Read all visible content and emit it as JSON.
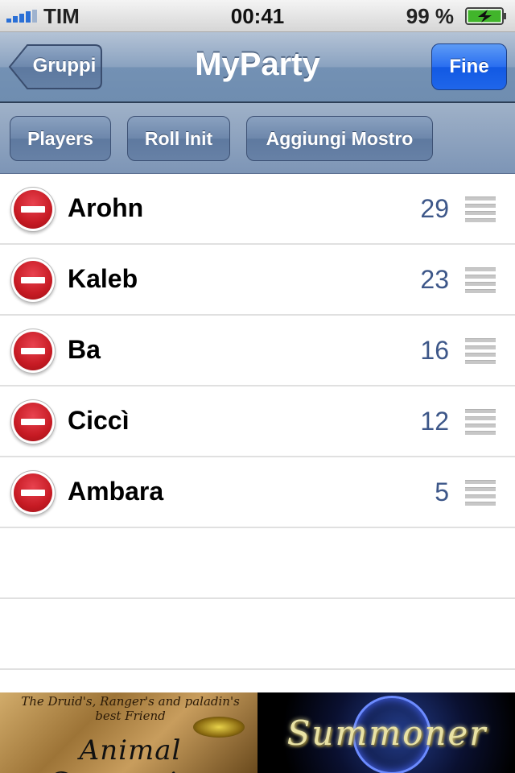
{
  "status_bar": {
    "carrier": "TIM",
    "time": "00:41",
    "battery_percent": "99 %",
    "signal_bars": 4,
    "battery_charging": true
  },
  "nav_bar": {
    "back_label": "Gruppi",
    "title": "MyParty",
    "done_label": "Fine"
  },
  "toolbar": {
    "players_label": "Players",
    "roll_init_label": "Roll Init",
    "add_monster_label": "Aggiungi Mostro"
  },
  "list": {
    "rows": [
      {
        "name": "Arohn",
        "value": "29"
      },
      {
        "name": "Kaleb",
        "value": "23"
      },
      {
        "name": "Ba",
        "value": "16"
      },
      {
        "name": "Ciccì",
        "value": "12"
      },
      {
        "name": "Ambara",
        "value": "5"
      }
    ]
  },
  "banner": {
    "left_tagline": "The Druid's, Ranger's and paladin's best Friend",
    "left_title": "Animal Companion",
    "right_title": "Summoner"
  },
  "colors": {
    "accent_blue": "#1f66ea",
    "value_text": "#3d5789",
    "delete_red": "#c71b24"
  },
  "icons": {
    "back": "chevron-left-icon",
    "delete": "minus-circle-icon",
    "reorder": "grip-lines-icon",
    "battery": "battery-charging-icon",
    "signal": "signal-bars-icon"
  }
}
